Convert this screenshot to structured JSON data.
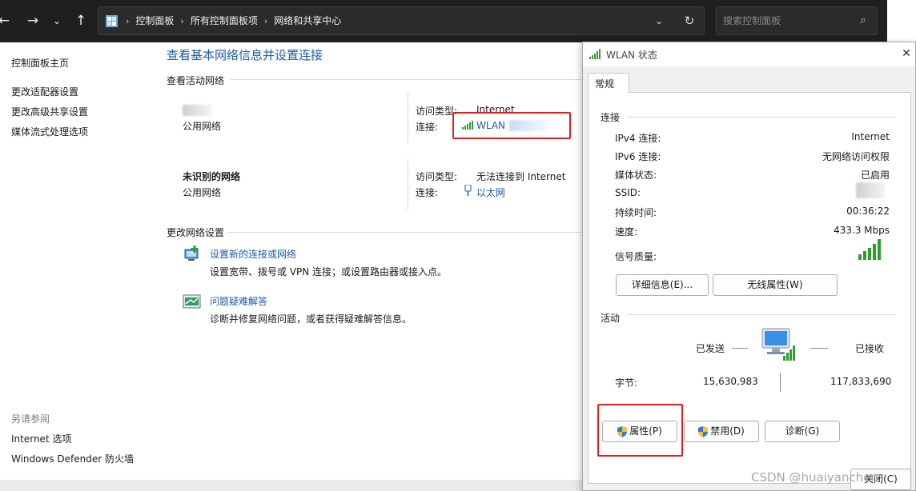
{
  "address_bar": {
    "crumbs": [
      "控制面板",
      "所有控制面板项",
      "网络和共享中心"
    ],
    "search_placeholder": "搜索控制面板"
  },
  "left_nav": {
    "items": [
      "控制面板主页",
      "更改适配器设置",
      "更改高级共享设置",
      "媒体流式处理选项"
    ],
    "see_also_heading": "另请参阅",
    "see_also": [
      "Internet 选项",
      "Windows Defender 防火墙"
    ]
  },
  "main": {
    "title": "查看基本网络信息并设置连接",
    "active_heading": "查看活动网络",
    "networks": [
      {
        "name": "",
        "category": "公用网络",
        "access_label": "访问类型:",
        "access_value": "Internet",
        "conn_label": "连接:",
        "conn_value": "WLAN"
      },
      {
        "name": "未识别的网络",
        "category": "公用网络",
        "access_label": "访问类型:",
        "access_value": "无法连接到 Internet",
        "conn_label": "连接:",
        "conn_value": "以太网"
      }
    ],
    "change_heading": "更改网络设置",
    "tasks": [
      {
        "link": "设置新的连接或网络",
        "desc": "设置宽带、拨号或 VPN 连接；或设置路由器或接入点。"
      },
      {
        "link": "问题疑难解答",
        "desc": "诊断并修复网络问题，或者获得疑难解答信息。"
      }
    ]
  },
  "dialog": {
    "title": "WLAN 状态",
    "tab": "常规",
    "connection_heading": "连接",
    "rows": [
      {
        "label": "IPv4 连接:",
        "value": "Internet"
      },
      {
        "label": "IPv6 连接:",
        "value": "无网络访问权限"
      },
      {
        "label": "媒体状态:",
        "value": "已启用"
      },
      {
        "label": "SSID:",
        "value": ""
      },
      {
        "label": "持续时间:",
        "value": "00:36:22"
      },
      {
        "label": "速度:",
        "value": "433.3 Mbps"
      }
    ],
    "signal_label": "信号质量:",
    "details_button": "详细信息(E)...",
    "wireless_button": "无线属性(W)",
    "activity_heading": "活动",
    "sent_label": "已发送",
    "received_label": "已接收",
    "bytes_label": "字节:",
    "bytes_sent": "15,630,983",
    "bytes_received": "117,833,690",
    "properties_button": "属性(P)",
    "disable_button": "禁用(D)",
    "diagnose_button": "诊断(G)",
    "close_button": "关闭(C)",
    "watermark": "CSDN @huaiyanchen"
  }
}
